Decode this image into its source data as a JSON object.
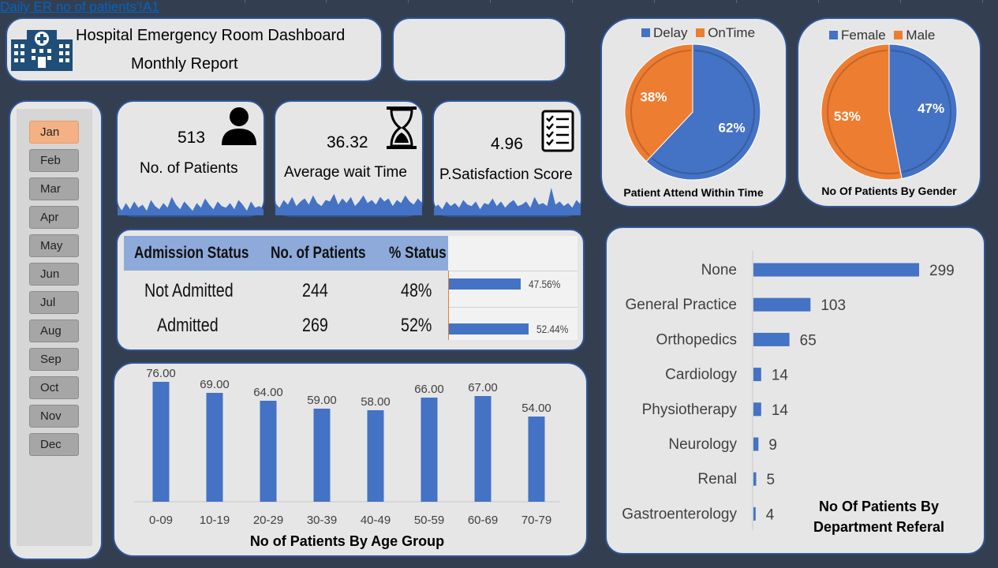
{
  "link_text": "Daily ER no of patients'!A1",
  "header": {
    "title": "Hospital Emergency Room Dashboard",
    "subtitle": "Monthly Report"
  },
  "months": [
    "Jan",
    "Feb",
    "Mar",
    "Apr",
    "May",
    "Jun",
    "Jul",
    "Aug",
    "Sep",
    "Oct",
    "Nov",
    "Dec"
  ],
  "selected_month": "Jan",
  "kpis": {
    "patients": {
      "value": "513",
      "label": "No. of Patients"
    },
    "wait": {
      "value": "36.32",
      "label": "Average wait Time"
    },
    "satisfaction": {
      "value": "4.96",
      "label": "P.Satisfaction Score"
    }
  },
  "admission": {
    "headers": [
      "Admission Status",
      "No. of Patients",
      "% Status"
    ],
    "rows": [
      {
        "status": "Not Admitted",
        "count": "244",
        "pct": "48%",
        "bar_value": 47.56,
        "bar_label": "47.56%"
      },
      {
        "status": "Admitted",
        "count": "269",
        "pct": "52%",
        "bar_value": 52.44,
        "bar_label": "52.44%"
      }
    ]
  },
  "colors": {
    "blue": "#4472c4",
    "orange": "#ed7d31",
    "panel": "#e6e6e6",
    "border": "#2f5597",
    "background": "#333f50",
    "selected_month": "#f4b183"
  },
  "chart_data": [
    {
      "type": "pie",
      "title": "Patient Attend Within Time",
      "labels": [
        "Delay",
        "OnTime"
      ],
      "values": [
        62,
        38
      ],
      "data_labels": [
        "62%",
        "38%"
      ],
      "colors": [
        "#4472c4",
        "#ed7d31"
      ],
      "legend": "top"
    },
    {
      "type": "pie",
      "title": "No Of Patients By Gender",
      "labels": [
        "Female",
        "Male"
      ],
      "values": [
        47,
        53
      ],
      "data_labels": [
        "47%",
        "53%"
      ],
      "colors": [
        "#4472c4",
        "#ed7d31"
      ],
      "legend": "top"
    },
    {
      "type": "bar",
      "title": "No of Patients By Age Group",
      "categories": [
        "0-09",
        "10-19",
        "20-29",
        "30-39",
        "40-49",
        "50-59",
        "60-69",
        "70-79"
      ],
      "values": [
        76,
        69,
        64,
        59,
        58,
        66,
        67,
        54
      ],
      "data_labels": [
        "76.00",
        "69.00",
        "64.00",
        "59.00",
        "58.00",
        "66.00",
        "67.00",
        "54.00"
      ],
      "ylim": [
        0,
        80
      ],
      "grid": false
    },
    {
      "type": "bar",
      "orientation": "horizontal",
      "title": "No Of Patients By Department Referal",
      "categories": [
        "None",
        "General Practice",
        "Orthopedics",
        "Cardiology",
        "Physiotherapy",
        "Neurology",
        "Renal",
        "Gastroenterology"
      ],
      "values": [
        299,
        103,
        65,
        14,
        14,
        9,
        5,
        4
      ],
      "xlim": [
        0,
        320
      ],
      "grid": false
    },
    {
      "type": "area",
      "title": "",
      "values": [
        6,
        3,
        8,
        4,
        9,
        5,
        7,
        3,
        10,
        6,
        4,
        8,
        5,
        12,
        7,
        4,
        9,
        6,
        3,
        8,
        5,
        11,
        7,
        4,
        9,
        6,
        5,
        8,
        4,
        10,
        7,
        3,
        9,
        5,
        6,
        4
      ],
      "ylim": [
        0,
        20
      ]
    },
    {
      "type": "area",
      "title": "",
      "values": [
        8,
        5,
        10,
        7,
        12,
        6,
        9,
        11,
        7,
        13,
        8,
        6,
        10,
        9,
        14,
        7,
        11,
        8,
        12,
        6,
        9,
        13,
        8,
        10,
        7,
        12,
        9,
        11,
        6,
        10,
        8,
        13,
        9,
        7,
        11,
        8
      ],
      "ylim": [
        0,
        20
      ]
    },
    {
      "type": "area",
      "title": "",
      "values": [
        5,
        7,
        4,
        9,
        6,
        8,
        5,
        10,
        7,
        6,
        9,
        4,
        8,
        7,
        11,
        6,
        9,
        5,
        8,
        10,
        6,
        7,
        9,
        5,
        12,
        7,
        8,
        6,
        18,
        7,
        9,
        6,
        8,
        5,
        10,
        7
      ],
      "ylim": [
        0,
        20
      ]
    }
  ]
}
